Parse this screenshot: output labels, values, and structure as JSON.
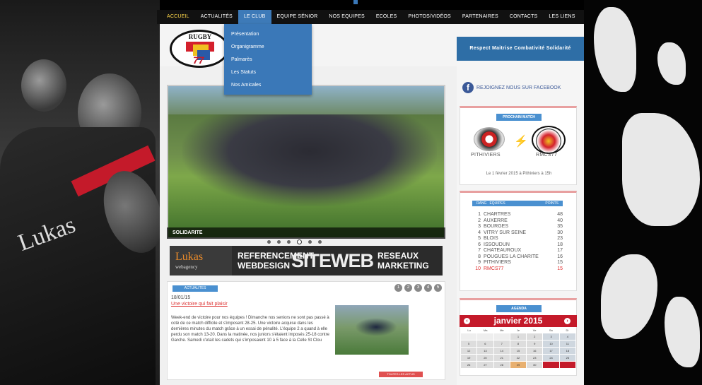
{
  "nav": {
    "items": [
      "Accueil",
      "Actualités",
      "Le club",
      "Equipe sénior",
      "Nos equipes",
      "Ecoles",
      "Photos/Vidéos",
      "Partenaires",
      "Contacts",
      "Les liens"
    ]
  },
  "dropdown": {
    "items": [
      "Présentation",
      "Organigramme",
      "Palmarès",
      "Les Statuts",
      "Nos Amicales"
    ]
  },
  "logo": {
    "top_text": "RUGBY",
    "number": "77"
  },
  "slogan": "Respect Maitrise Combativité Solidarité",
  "slider": {
    "caption": "SOLIDARITE",
    "dot_count": 6,
    "active_dot": 3
  },
  "banner": {
    "logo_main": "Lukas",
    "logo_sub": "webagency",
    "text1_line1": "REFERENCEMENT",
    "text1_line2": "WEBDESIGN",
    "big": "SITEWEB",
    "text2_line1": "RESEAUX",
    "text2_line2": "MARKETING"
  },
  "news": {
    "label": "ACTUALITES",
    "date": "18/01/15",
    "title": "Une victoire qui fait plaisir",
    "text": "Week-end de victoire pour nos équipes ! Dimanche nos seniors ne sont pas passé à coté de ce match difficile et s'imposent 28-25. Une victoire acquise dans les dernières minutes du match grâce à un essai de pénalité. L'équipe 2 a quand à elle perdu son match 13-20. Dans la matinée, nos juniors s'étaient imposés 25-18 contre Garche. Samedi c'etait les cadets qui s'imposaient 10 à 5 face à la Celle St Clou",
    "more": "TOUTES LES ACTUS",
    "nav": [
      "1",
      "2",
      "3",
      "4",
      "5"
    ]
  },
  "sidebar": {
    "facebook": "REJOIGNEZ NOUS SUR FACEBOOK",
    "next_match_label": "PROCHAIN MATCH",
    "team_home": "PITHIVIERS",
    "team_away": "RMCS77",
    "match_date": "Le 1 février 2015 à Pithiviers à 15h",
    "ranking": {
      "col_rank": "RANG",
      "col_team": "EQUIPES",
      "col_points": "POINTS",
      "rows": [
        {
          "rank": "1",
          "team": "CHARTRES",
          "points": "48"
        },
        {
          "rank": "2",
          "team": "AUXERRE",
          "points": "40"
        },
        {
          "rank": "3",
          "team": "BOURGES",
          "points": "35"
        },
        {
          "rank": "4",
          "team": "VITRY SUR SEINE",
          "points": "30"
        },
        {
          "rank": "5",
          "team": "BLOIS",
          "points": "23"
        },
        {
          "rank": "6",
          "team": "ISSOUDUN",
          "points": "18"
        },
        {
          "rank": "7",
          "team": "CHATEAUROUX",
          "points": "17"
        },
        {
          "rank": "8",
          "team": "POUGUES LA CHARITE",
          "points": "16"
        },
        {
          "rank": "9",
          "team": "PITHIVIERS",
          "points": "15"
        },
        {
          "rank": "10",
          "team": "RMCS77",
          "points": "15",
          "highlight": true
        }
      ]
    },
    "agenda": {
      "label": "AGENDA",
      "month": "janvier 2015",
      "prev": "‹",
      "next": "›",
      "days": [
        "Lu",
        "Ma",
        "Me",
        "Je",
        "Ve",
        "Sa",
        "Di"
      ],
      "cells": [
        "",
        "",
        "",
        "1",
        "2",
        "3",
        "4",
        "5",
        "6",
        "7",
        "8",
        "9",
        "10",
        "11",
        "12",
        "13",
        "14",
        "15",
        "16",
        "17",
        "18",
        "19",
        "20",
        "21",
        "22",
        "23",
        "24",
        "25",
        "26",
        "27",
        "28",
        "29",
        "30",
        "",
        ""
      ]
    }
  },
  "colors": {
    "accent": "#3a78b8",
    "brand_red": "#c41a2a",
    "nav_active": "#ffd84a",
    "facebook": "#3b5998"
  }
}
